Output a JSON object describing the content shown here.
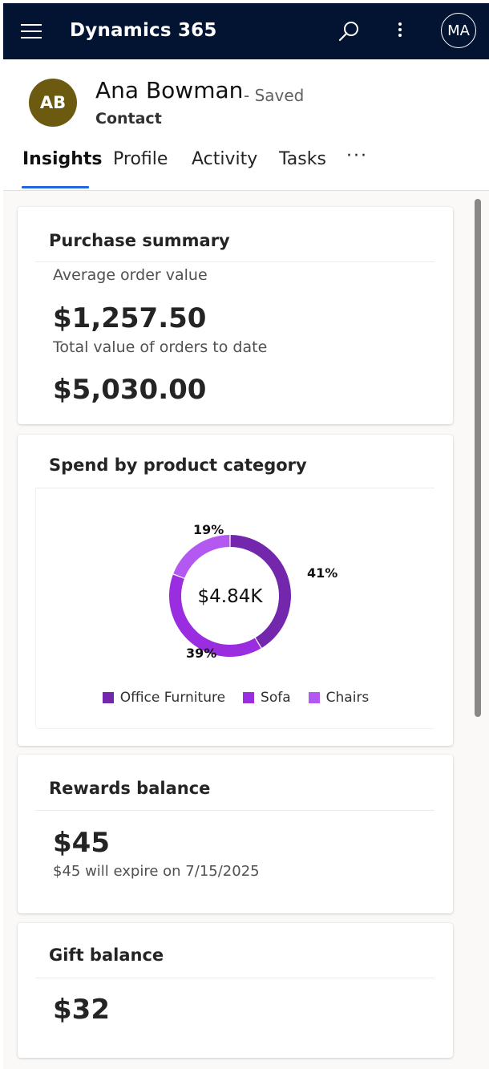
{
  "app": {
    "title": "Dynamics 365",
    "user_initials": "MA"
  },
  "record": {
    "initials": "AB",
    "name": "Ana Bowman",
    "save_status": "- Saved",
    "type": "Contact",
    "avatar_color": "#6b5a10"
  },
  "tabs": [
    {
      "label": "Insights",
      "active": true
    },
    {
      "label": "Profile",
      "active": false
    },
    {
      "label": "Activity",
      "active": false
    },
    {
      "label": "Tasks",
      "active": false
    }
  ],
  "tabs_more": "···",
  "purchase_summary": {
    "title": "Purchase summary",
    "avg_label": "Average order value",
    "avg_value": "$1,257.50",
    "total_label": "Total value of orders to date",
    "total_value": "$5,030.00"
  },
  "spend": {
    "title": "Spend by product category",
    "center_label": "$4.84K",
    "legend": [
      "Office Furniture",
      "Sofa",
      "Chairs"
    ]
  },
  "chart_data": {
    "type": "pie",
    "categories": [
      "Office Furniture",
      "Sofa",
      "Chairs"
    ],
    "values": [
      41,
      39,
      19
    ],
    "labels": [
      "41%",
      "39%",
      "19%"
    ],
    "colors": [
      "#7327ad",
      "#9b2de0",
      "#b358f0"
    ],
    "total": "$4.84K"
  },
  "rewards": {
    "title": "Rewards balance",
    "value": "$45",
    "note": "$45 will expire on 7/15/2025"
  },
  "gift": {
    "title": "Gift balance",
    "value": "$32"
  }
}
